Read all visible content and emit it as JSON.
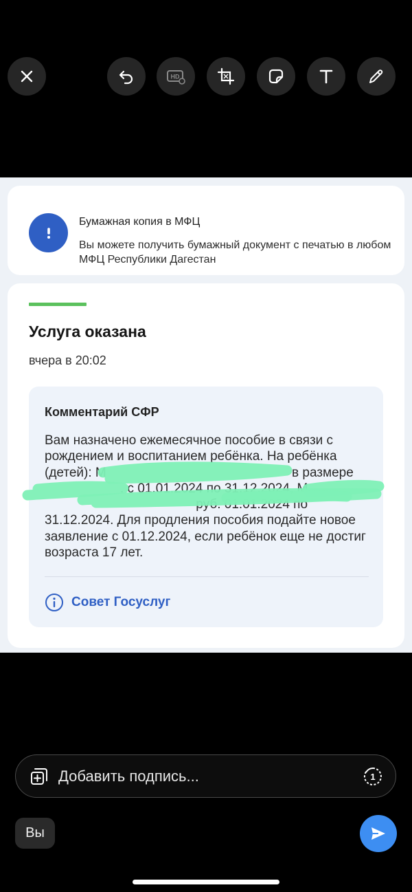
{
  "toolbar": {
    "icons": [
      "close-icon",
      "undo-icon",
      "hd-quality-icon",
      "crop-icon",
      "sticker-icon",
      "text-icon",
      "draw-icon"
    ]
  },
  "info_card": {
    "title": "Бумажная копия в МФЦ",
    "text": "Вы можете получить бумажный документ с печатью в любом МФЦ Республики Дагестан"
  },
  "status_card": {
    "title": "Услуга оказана",
    "time": "вчера в 20:02",
    "accent_color": "#5bc15d",
    "comment": {
      "title": "Комментарий СФР",
      "text_before": "Вам назначено ежемесячное пособие в связи с рождением и воспитанием ребёнка. На ребёнка (детей): М",
      "text_mid1": " в размере ",
      "text_mid2": ". с 01.01.2024 по 31.12.2024, М",
      "text_mid3": " руб. ",
      "text_after": "01.01.2024 по 31.12.2024. Для продления пособия подайте новое заявление с 01.12.2024, если ребёнок еще не достиг возраста 17 лет."
    },
    "tip_label": "Совет Госуслуг"
  },
  "caption": {
    "placeholder": "Добавить подпись..."
  },
  "recipient_label": "Вы",
  "colors": {
    "brand_blue": "#2f5fc4",
    "send_blue": "#3d8ef2",
    "redaction": "#7ef0b6"
  }
}
